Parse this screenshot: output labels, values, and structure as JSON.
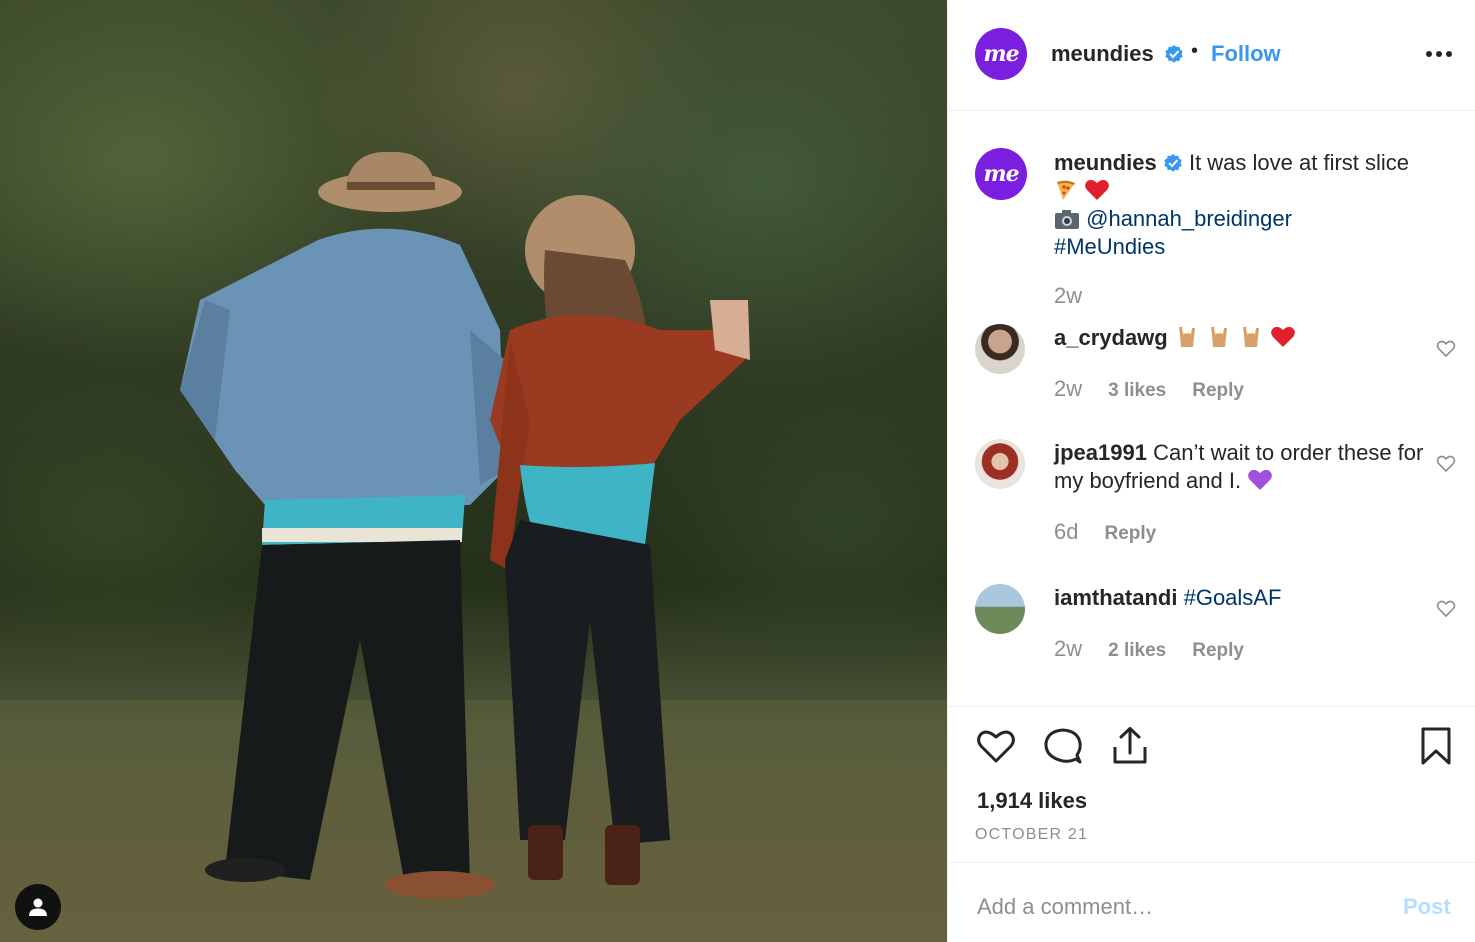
{
  "post": {
    "brand_avatar_text": "me",
    "username": "meundies",
    "dot": "•",
    "follow_label": "Follow"
  },
  "caption": {
    "username": "meundies",
    "text": "It was love at first slice",
    "credit_handle": "@hannah_breidinger",
    "hashtag": "#MeUndies",
    "time": "2w"
  },
  "comments": [
    {
      "username": "a_crydawg",
      "text": "",
      "time": "2w",
      "likes": "3 likes",
      "reply": "Reply"
    },
    {
      "username": "jpea1991",
      "text": "Can’t wait to order these for my boyfriend and I.",
      "time": "6d",
      "likes": "",
      "reply": "Reply"
    },
    {
      "username": "iamthatandi",
      "text": "#GoalsAF",
      "time": "2w",
      "likes": "2 likes",
      "reply": "Reply"
    }
  ],
  "stats": {
    "likes": "1,914 likes",
    "date": "OCTOBER 21"
  },
  "add_comment": {
    "placeholder": "Add a comment…",
    "post_label": "Post"
  },
  "colors": {
    "brand": "#7a1fe0",
    "link": "#003569",
    "follow": "#3897f0",
    "muted": "#8e8e8e"
  },
  "icons": [
    "user-tag-icon",
    "verified-badge-icon",
    "more-options-icon",
    "heart-icon",
    "comment-icon",
    "share-icon",
    "bookmark-icon",
    "pizza-emoji",
    "red-heart-emoji",
    "camera-emoji",
    "rock-on-emoji",
    "purple-heart-emoji"
  ]
}
